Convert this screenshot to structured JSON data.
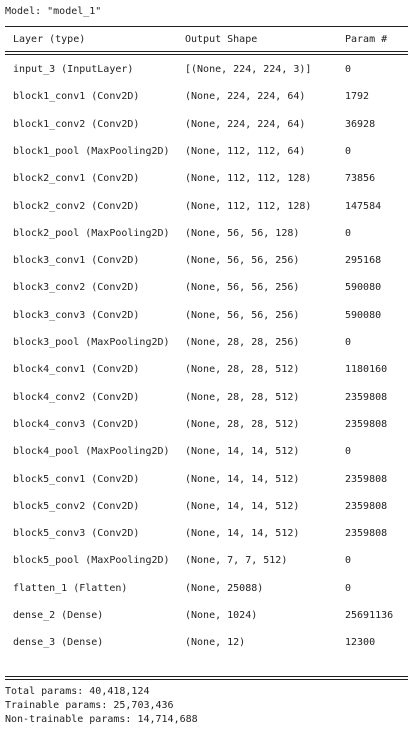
{
  "model_title": "Model: \"model_1\"",
  "header": {
    "layer": "Layer (type)",
    "shape": "Output Shape",
    "params": "Param #"
  },
  "rows": [
    {
      "layer": "input_3 (InputLayer)",
      "shape": "[(None, 224, 224, 3)]",
      "params": "0"
    },
    {
      "layer": "block1_conv1 (Conv2D)",
      "shape": "(None, 224, 224, 64)",
      "params": "1792"
    },
    {
      "layer": "block1_conv2 (Conv2D)",
      "shape": "(None, 224, 224, 64)",
      "params": "36928"
    },
    {
      "layer": "block1_pool (MaxPooling2D)",
      "shape": "(None, 112, 112, 64)",
      "params": "0"
    },
    {
      "layer": "block2_conv1 (Conv2D)",
      "shape": "(None, 112, 112, 128)",
      "params": "73856"
    },
    {
      "layer": "block2_conv2 (Conv2D)",
      "shape": "(None, 112, 112, 128)",
      "params": "147584"
    },
    {
      "layer": "block2_pool (MaxPooling2D)",
      "shape": "(None, 56, 56, 128)",
      "params": "0"
    },
    {
      "layer": "block3_conv1 (Conv2D)",
      "shape": "(None, 56, 56, 256)",
      "params": "295168"
    },
    {
      "layer": "block3_conv2 (Conv2D)",
      "shape": "(None, 56, 56, 256)",
      "params": "590080"
    },
    {
      "layer": "block3_conv3 (Conv2D)",
      "shape": "(None, 56, 56, 256)",
      "params": "590080"
    },
    {
      "layer": "block3_pool (MaxPooling2D)",
      "shape": "(None, 28, 28, 256)",
      "params": "0"
    },
    {
      "layer": "block4_conv1 (Conv2D)",
      "shape": "(None, 28, 28, 512)",
      "params": "1180160"
    },
    {
      "layer": "block4_conv2 (Conv2D)",
      "shape": "(None, 28, 28, 512)",
      "params": "2359808"
    },
    {
      "layer": "block4_conv3 (Conv2D)",
      "shape": "(None, 28, 28, 512)",
      "params": "2359808"
    },
    {
      "layer": "block4_pool (MaxPooling2D)",
      "shape": "(None, 14, 14, 512)",
      "params": "0"
    },
    {
      "layer": "block5_conv1 (Conv2D)",
      "shape": "(None, 14, 14, 512)",
      "params": "2359808"
    },
    {
      "layer": "block5_conv2 (Conv2D)",
      "shape": "(None, 14, 14, 512)",
      "params": "2359808"
    },
    {
      "layer": "block5_conv3 (Conv2D)",
      "shape": "(None, 14, 14, 512)",
      "params": "2359808"
    },
    {
      "layer": "block5_pool (MaxPooling2D)",
      "shape": "(None, 7, 7, 512)",
      "params": "0"
    },
    {
      "layer": "flatten_1 (Flatten)",
      "shape": "(None, 25088)",
      "params": "0"
    },
    {
      "layer": "dense_2 (Dense)",
      "shape": "(None, 1024)",
      "params": "25691136"
    },
    {
      "layer": "dense_3 (Dense)",
      "shape": "(None, 12)",
      "params": "12300"
    }
  ],
  "totals": {
    "total": "Total params: 40,418,124",
    "trainable": "Trainable params: 25,703,436",
    "non_trainable": "Non-trainable params: 14,714,688"
  }
}
